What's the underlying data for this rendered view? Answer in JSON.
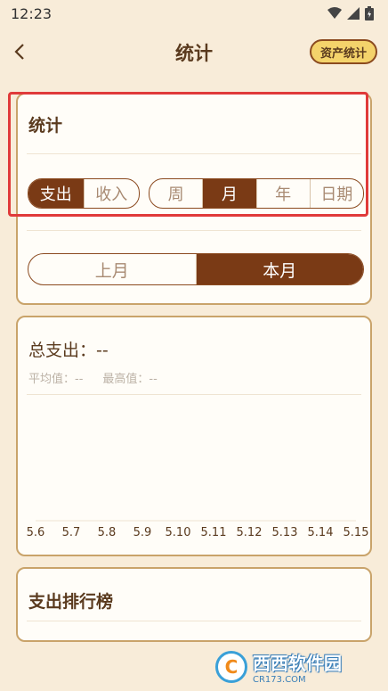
{
  "status_bar": {
    "time": "12:23"
  },
  "header": {
    "title": "统计",
    "asset_button_label": "资产统计"
  },
  "stats_card": {
    "title": "统计",
    "type_tabs": [
      {
        "label": "支出",
        "active": true
      },
      {
        "label": "收入",
        "active": false
      }
    ],
    "period_tabs": [
      {
        "label": "周",
        "active": false
      },
      {
        "label": "月",
        "active": true
      },
      {
        "label": "年",
        "active": false
      },
      {
        "label": "日期",
        "active": false
      }
    ],
    "month_tabs": [
      {
        "label": "上月",
        "active": false
      },
      {
        "label": "本月",
        "active": true
      }
    ]
  },
  "chart_card": {
    "total_label": "总支出：--",
    "average_label": "平均值：--",
    "max_label": "最高值：--"
  },
  "chart_data": {
    "type": "line",
    "categories": [
      "5.6",
      "5.7",
      "5.8",
      "5.9",
      "5.10",
      "5.11",
      "5.12",
      "5.13",
      "5.14",
      "5.15"
    ],
    "values": []
  },
  "ranking_card": {
    "title": "支出排行榜"
  },
  "watermark": {
    "text": "西西软件园",
    "url": "CR173.COM"
  },
  "colors": {
    "background": "#f8ecd9",
    "accent": "#7a3a15",
    "card_border": "#c9a36a",
    "button_yellow": "#f4d36b",
    "highlight_red": "#e03a3a"
  }
}
